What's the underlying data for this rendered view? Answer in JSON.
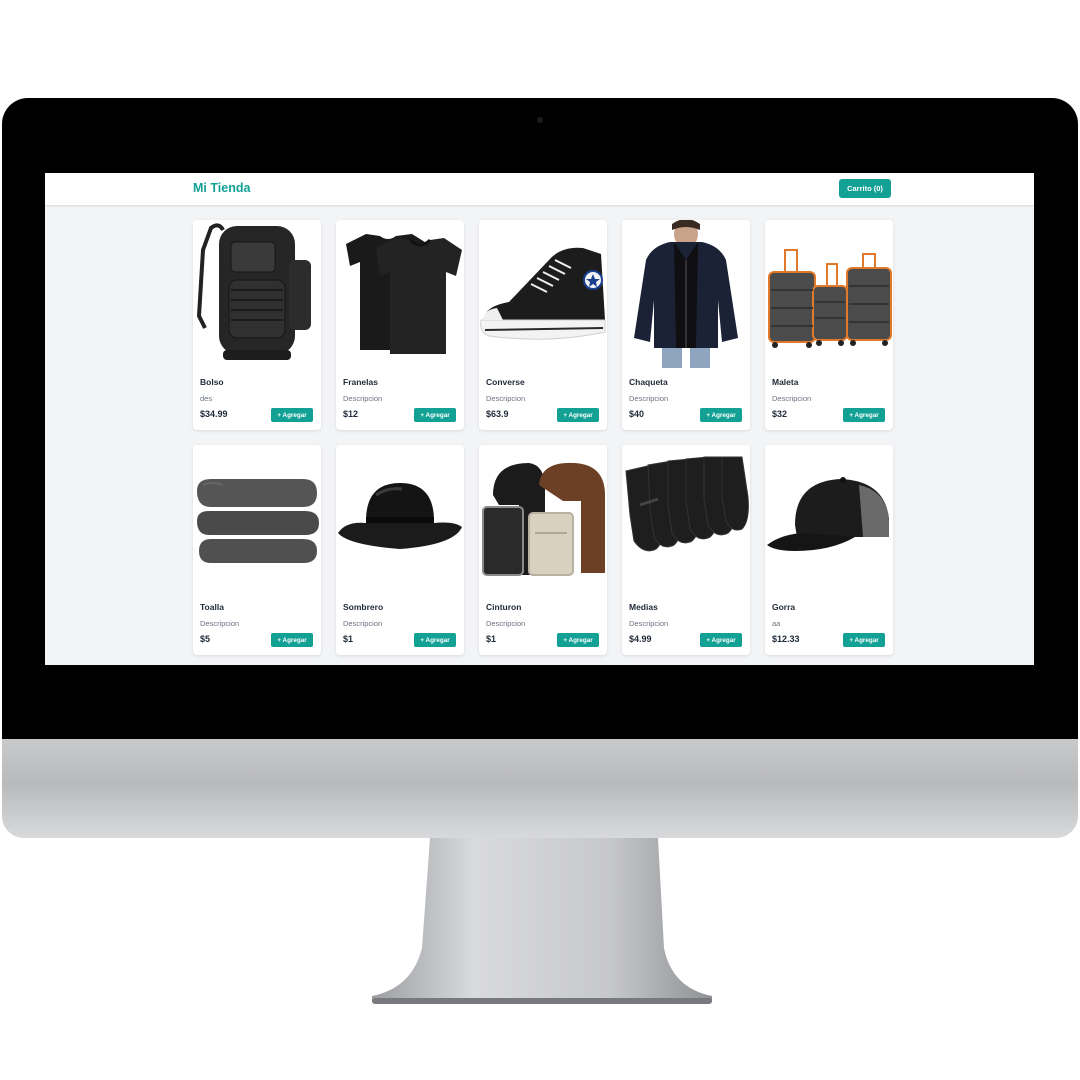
{
  "app": {
    "brand": "Mi Tienda",
    "cart_label": "Carrito (0)",
    "accent_color": "#14a195"
  },
  "products": [
    {
      "name": "Bolso",
      "description": "des",
      "price": "$34.99",
      "add_label": "+ Agregar",
      "icon": "backpack-image"
    },
    {
      "name": "Franelas",
      "description": "Descripcion",
      "price": "$12",
      "add_label": "+ Agregar",
      "icon": "tshirts-image"
    },
    {
      "name": "Converse",
      "description": "Descripcion",
      "price": "$63.9",
      "add_label": "+ Agregar",
      "icon": "sneaker-image"
    },
    {
      "name": "Chaqueta",
      "description": "Descripcion",
      "price": "$40",
      "add_label": "+ Agregar",
      "icon": "jacket-image"
    },
    {
      "name": "Maleta",
      "description": "Descripcion",
      "price": "$32",
      "add_label": "+ Agregar",
      "icon": "luggage-image"
    },
    {
      "name": "Toalla",
      "description": "Descripcion",
      "price": "$5",
      "add_label": "+ Agregar",
      "icon": "towel-image"
    },
    {
      "name": "Sombrero",
      "description": "Descripcion",
      "price": "$1",
      "add_label": "+ Agregar",
      "icon": "bowler-hat-image"
    },
    {
      "name": "Cinturon",
      "description": "Descripcion",
      "price": "$1",
      "add_label": "+ Agregar",
      "icon": "belt-image"
    },
    {
      "name": "Medias",
      "description": "Descripcion",
      "price": "$4.99",
      "add_label": "+ Agregar",
      "icon": "socks-image"
    },
    {
      "name": "Gorra",
      "description": "aa",
      "price": "$12.33",
      "add_label": "+ Agregar",
      "icon": "cap-image"
    }
  ]
}
